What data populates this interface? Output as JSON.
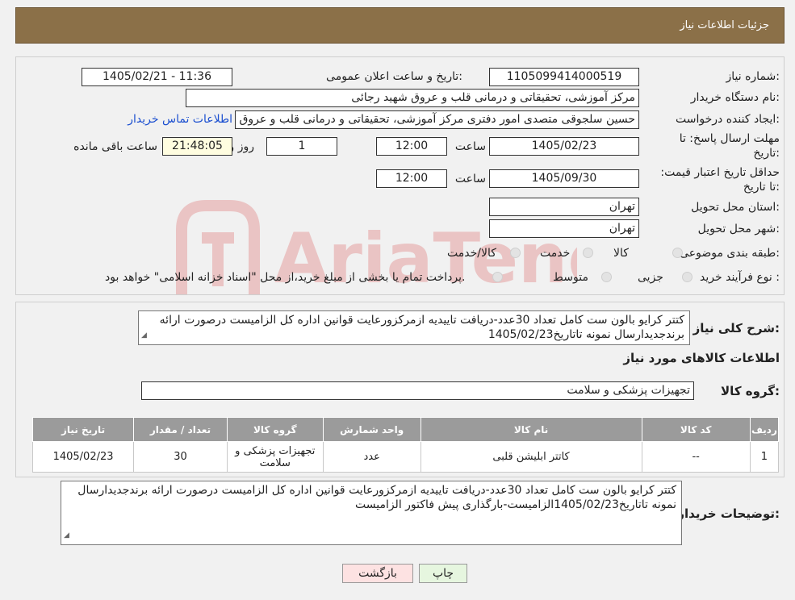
{
  "header": {
    "title": "جزئیات اطلاعات نیاز"
  },
  "labels": {
    "need_number": "شماره نیاز:",
    "announce_datetime": "تاریخ و ساعت اعلان عمومی:",
    "buyer_org": "نام دستگاه خریدار:",
    "requester": "ایجاد کننده درخواست:",
    "reply_deadline": "مهلت ارسال پاسخ: تا تاریخ:",
    "price_validity": "حداقل تاریخ اعتبار قیمت: تا تاریخ:",
    "hour": "ساعت",
    "day_and": "روز و",
    "remaining": "ساعت باقی مانده",
    "province": "استان محل تحویل:",
    "city": "شهر محل تحویل:",
    "category": "طبقه بندی موضوعی:",
    "process_type": "نوع فرآیند خرید :",
    "summary": "شرح کلی نیاز:",
    "goods_info": "اطلاعات کالاهای مورد نیاز",
    "goods_group": "گروه کالا:",
    "buyer_notes": "توضیحات خریدار:"
  },
  "fields": {
    "need_number": "1105099414000519",
    "announce_datetime": "1405/02/21 - 11:36",
    "buyer_org": "مرکز آموزشی، تحقیقاتی و درمانی قلب و عروق شهید رجائی",
    "requester": "حسین سلجوقی متصدی امور دفتری مرکز آموزشی، تحقیقاتی و درمانی قلب و عروق",
    "contact_link": "اطلاعات تماس خریدار",
    "reply_date": "1405/02/23",
    "reply_time": "12:00",
    "reply_days": "1",
    "reply_remaining": "21:48:05",
    "validity_date": "1405/09/30",
    "validity_time": "12:00",
    "province": "تهران",
    "city": "تهران"
  },
  "category_options": [
    "کالا",
    "خدمت",
    "کالا/خدمت"
  ],
  "process_options": [
    "جزیی",
    "متوسط"
  ],
  "process_note": "پرداخت تمام یا بخشی از مبلغ خرید،از محل \"اسناد خزانه اسلامی\" خواهد بود.",
  "summary_text": "کتتر کرایو بالون ست کامل تعداد 30عدد-دریافت تاییدیه ازمرکزورعایت قوانین اداره کل الزامیست درصورت ارائه برندجدیدارسال نمونه تاتاریخ1405/02/23",
  "goods_group": "تجهیزات پزشکی و سلامت",
  "table": {
    "headers": [
      "ردیف",
      "کد کالا",
      "نام کالا",
      "واحد شمارش",
      "گروه کالا",
      "تعداد / مقدار",
      "تاریخ نیاز"
    ],
    "rows": [
      [
        "1",
        "--",
        "کاتتر ابلیشن قلبی",
        "عدد",
        "تجهیزات پزشکی و سلامت",
        "30",
        "1405/02/23"
      ]
    ]
  },
  "buyer_notes_text": "کتتر کرایو بالون ست کامل تعداد 30عدد-دریافت تاییدیه ازمرکزورعایت قوانین اداره کل الزامیست درصورت ارائه برندجدیدارسال نمونه تاتاریخ1405/02/23الزامیست-بارگذاری پیش فاکتور الزامیست",
  "buttons": {
    "print": "چاپ",
    "back": "بازگشت"
  },
  "watermark_text": "AriaTender.neT",
  "colors": {
    "header_bg": "#8b7048",
    "link": "#1b4fd0",
    "table_header": "#9b9b9b",
    "back_btn_bg": "#fde2e2",
    "print_btn_bg": "#e6f6df"
  }
}
